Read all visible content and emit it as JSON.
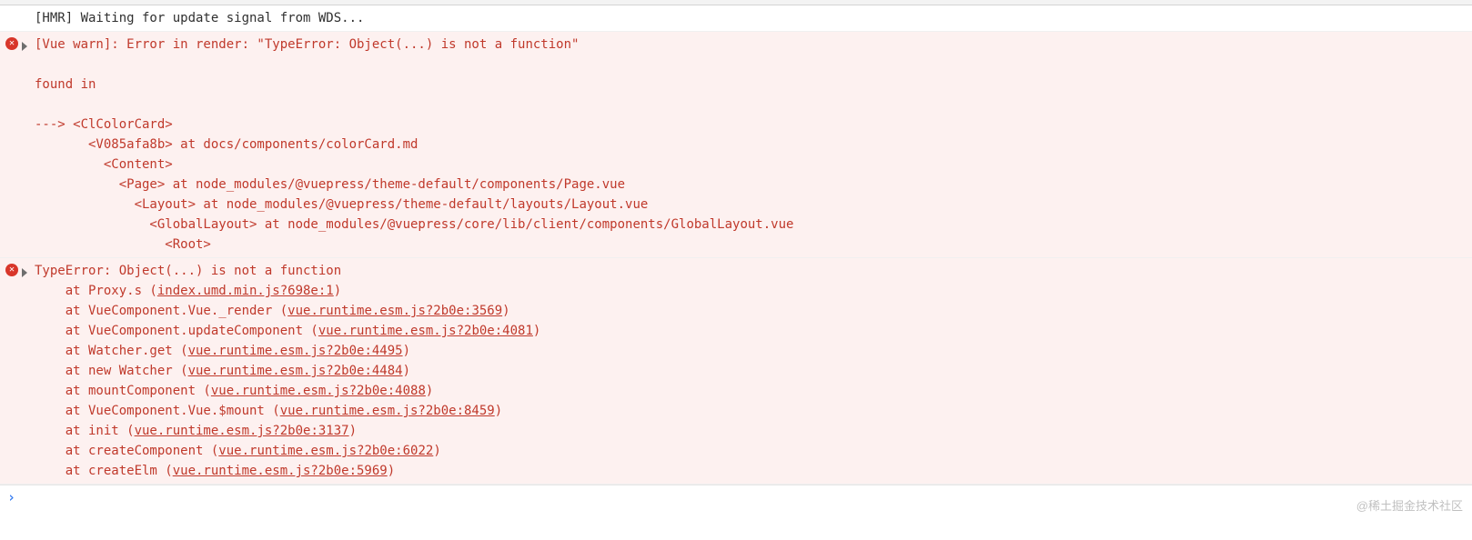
{
  "log_hmr": "[HMR] Waiting for update signal from WDS...",
  "err1": {
    "header": "[Vue warn]: Error in render: \"TypeError: Object(...) is not a function\"",
    "found_in": "found in",
    "tree": [
      "---> <ClColorCard>",
      "       <V085afa8b> at docs/components/colorCard.md",
      "         <Content>",
      "           <Page> at node_modules/@vuepress/theme-default/components/Page.vue",
      "             <Layout> at node_modules/@vuepress/theme-default/layouts/Layout.vue",
      "               <GlobalLayout> at node_modules/@vuepress/core/lib/client/components/GlobalLayout.vue",
      "                 <Root>"
    ]
  },
  "err2": {
    "header": "TypeError: Object(...) is not a function",
    "stack": [
      {
        "prefix": "    at Proxy.s (",
        "link": "index.umd.min.js?698e:1",
        "suffix": ")"
      },
      {
        "prefix": "    at VueComponent.Vue._render (",
        "link": "vue.runtime.esm.js?2b0e:3569",
        "suffix": ")"
      },
      {
        "prefix": "    at VueComponent.updateComponent (",
        "link": "vue.runtime.esm.js?2b0e:4081",
        "suffix": ")"
      },
      {
        "prefix": "    at Watcher.get (",
        "link": "vue.runtime.esm.js?2b0e:4495",
        "suffix": ")"
      },
      {
        "prefix": "    at new Watcher (",
        "link": "vue.runtime.esm.js?2b0e:4484",
        "suffix": ")"
      },
      {
        "prefix": "    at mountComponent (",
        "link": "vue.runtime.esm.js?2b0e:4088",
        "suffix": ")"
      },
      {
        "prefix": "    at VueComponent.Vue.$mount (",
        "link": "vue.runtime.esm.js?2b0e:8459",
        "suffix": ")"
      },
      {
        "prefix": "    at init (",
        "link": "vue.runtime.esm.js?2b0e:3137",
        "suffix": ")"
      },
      {
        "prefix": "    at createComponent (",
        "link": "vue.runtime.esm.js?2b0e:6022",
        "suffix": ")"
      },
      {
        "prefix": "    at createElm (",
        "link": "vue.runtime.esm.js?2b0e:5969",
        "suffix": ")"
      }
    ]
  },
  "prompt_caret": "›",
  "watermark": "@稀土掘金技术社区"
}
